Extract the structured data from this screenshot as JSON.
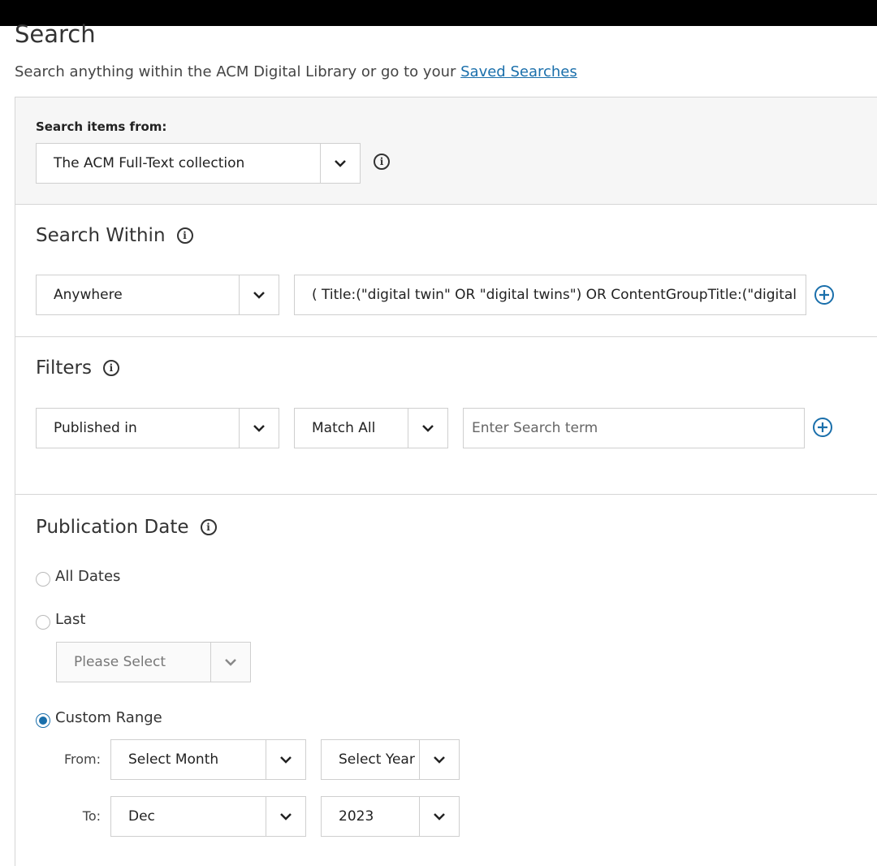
{
  "page": {
    "title": "Search",
    "intro_text": "Search anything within the ACM Digital Library or go to your ",
    "saved_searches_link": "Saved Searches"
  },
  "search_items": {
    "label": "Search items from:",
    "selected": "The ACM Full-Text collection"
  },
  "search_within": {
    "heading": "Search Within",
    "field_selected": "Anywhere",
    "query_value": "( Title:(\"digital twin\" OR \"digital twins\")  OR ContentGroupTitle:(\"digital"
  },
  "filters": {
    "heading": "Filters",
    "field_selected": "Published in",
    "match_selected": "Match All",
    "term_placeholder": "Enter Search term"
  },
  "publication_date": {
    "heading": "Publication Date",
    "options": {
      "all_dates": "All Dates",
      "last": "Last",
      "custom_range": "Custom Range"
    },
    "selected_option": "custom_range",
    "last_select": "Please Select",
    "from_label": "From:",
    "from_month": "Select Month",
    "from_year": "Select Year",
    "to_label": "To:",
    "to_month": "Dec",
    "to_year": "2023"
  },
  "colors": {
    "accent": "#1a6fab",
    "panel_bg": "#f6f6f6",
    "border": "#d5d5d5"
  },
  "icons": [
    "info-icon",
    "chevron-down-icon",
    "plus-circle-icon"
  ]
}
